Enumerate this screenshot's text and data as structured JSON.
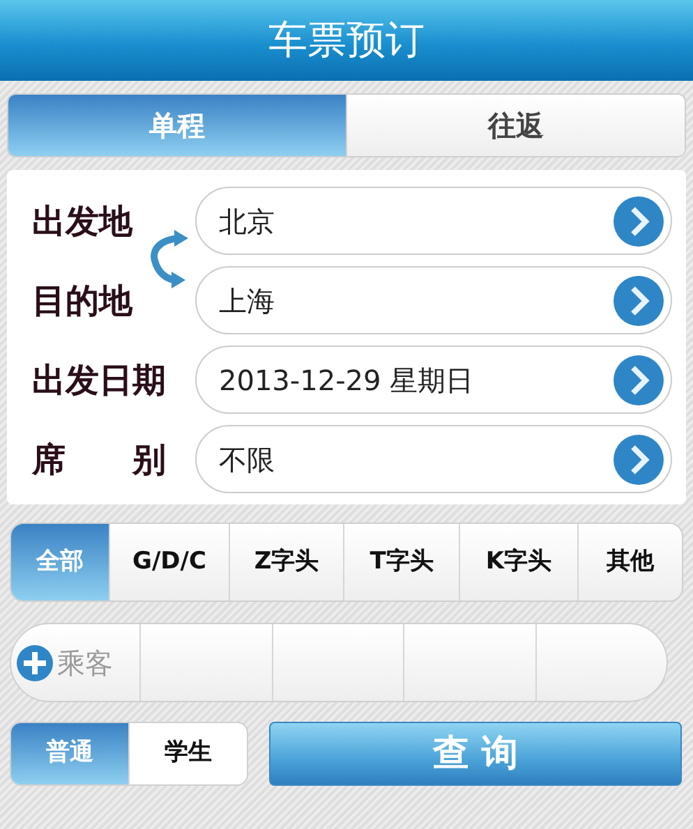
{
  "title": "车票预订",
  "trip_tabs": [
    {
      "label": "单程",
      "selected": true
    },
    {
      "label": "往返",
      "selected": false
    }
  ],
  "form": [
    {
      "label": "出发地",
      "value": "北京"
    },
    {
      "label": "目的地",
      "value": "上海"
    },
    {
      "label": "出发日期",
      "value": "2013-12-29 星期日"
    },
    {
      "label": "席　　别",
      "value": "不限"
    }
  ],
  "train_types": [
    {
      "label": "全部",
      "selected": true
    },
    {
      "label": "G/D/C",
      "selected": false
    },
    {
      "label": "Z字头",
      "selected": false
    },
    {
      "label": "T字头",
      "selected": false
    },
    {
      "label": "K字头",
      "selected": false
    },
    {
      "label": "其他",
      "selected": false
    }
  ],
  "passenger_button": "乘客",
  "ticket_types": [
    {
      "label": "普通",
      "selected": true
    },
    {
      "label": "学生",
      "selected": false
    }
  ],
  "search_button": "查 询"
}
